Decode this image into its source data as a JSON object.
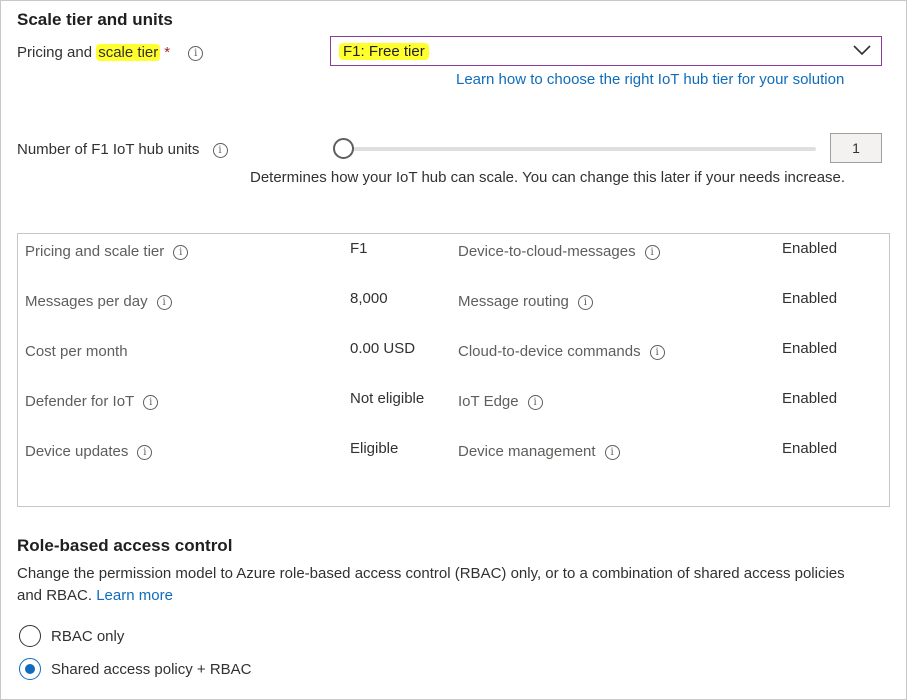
{
  "scale_section": {
    "title": "Scale tier and units",
    "pricing_label_pre": "Pricing and",
    "pricing_label_hl": "scale tier",
    "required_mark": "*",
    "tier_selected": "F1: Free tier",
    "learn_tier_link": "Learn how to choose the right IoT hub tier for your solution",
    "units_label": "Number of F1 IoT hub units",
    "units_value": "1",
    "units_slider_level": 0,
    "units_hint": "Determines how your IoT hub can scale. You can change this later if your needs increase."
  },
  "summary": {
    "left": [
      {
        "label": "Pricing and scale tier",
        "value": "F1",
        "info": true
      },
      {
        "label": "Messages per day",
        "value": "8,000",
        "info": true
      },
      {
        "label": "Cost per month",
        "value": "0.00 USD",
        "info": false
      },
      {
        "label": "Defender for IoT",
        "value": "Not eligible",
        "info": true
      },
      {
        "label": "Device updates",
        "value": "Eligible",
        "info": true
      }
    ],
    "right": [
      {
        "label": "Device-to-cloud-messages",
        "value": "Enabled",
        "info": true
      },
      {
        "label": "Message routing",
        "value": "Enabled",
        "info": true
      },
      {
        "label": "Cloud-to-device commands",
        "value": "Enabled",
        "info": true
      },
      {
        "label": "IoT Edge",
        "value": "Enabled",
        "info": true
      },
      {
        "label": "Device management",
        "value": "Enabled",
        "info": true
      }
    ]
  },
  "rbac_section": {
    "title": "Role-based access control",
    "description": "Change the permission model to Azure role-based access control (RBAC) only, or to a combination of shared access policies and RBAC.",
    "learn_more": "Learn more",
    "options": [
      {
        "label": "RBAC only",
        "selected": false
      },
      {
        "label": "Shared access policy + RBAC",
        "selected": true
      }
    ]
  },
  "icons": {
    "info": "info-icon",
    "dropdown": "chevron-down-icon"
  },
  "colors": {
    "accent": "#0f6cbd",
    "highlight": "#ffff2e",
    "dropdown_border": "#8a3b9c",
    "required": "#a4262c"
  }
}
